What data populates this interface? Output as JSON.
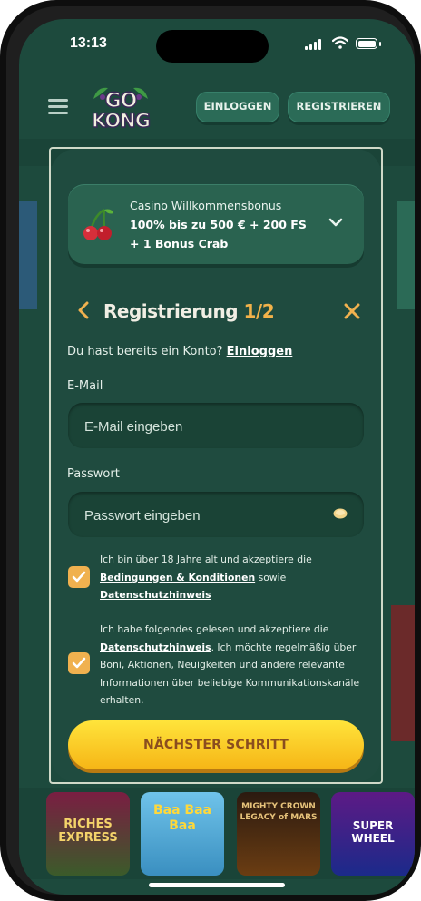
{
  "status_bar": {
    "time": "13:13"
  },
  "header": {
    "logo_top": "GO",
    "logo_bottom": "KONG",
    "login_label": "EINLOGGEN",
    "register_label": "REGISTRIEREN"
  },
  "bonus": {
    "title": "Casino Willkommensbonus",
    "line1": "100% bis zu 500 € + 200 FS",
    "line2": "+ 1 Bonus Crab"
  },
  "registration": {
    "title": "Registrierung",
    "step": "1/2",
    "have_account_text": "Du hast bereits ein Konto?",
    "login_link": "Einloggen",
    "email_label": "E-Mail",
    "email_placeholder": "E-Mail eingeben",
    "password_label": "Passwort",
    "password_placeholder": "Passwort eingeben",
    "consent1": {
      "text_a": "Ich bin über 18 Jahre alt und akzeptiere die",
      "link_a": "Bedingungen & Konditionen",
      "text_b": "sowie",
      "link_b": "Datenschutzhinweis"
    },
    "consent2": {
      "text_a": "Ich habe folgendes gelesen und akzeptiere die",
      "link_a": "Datenschutzhinweis",
      "text_b": ". Ich möchte regelmäßig über Boni, Aktionen, Neuigkeiten und andere relevante Informationen über beliebige Kommunikationskanäle erhalten."
    },
    "next_button": "NÄCHSTER SCHRITT"
  },
  "games": [
    {
      "label": "RICHES EXPRESS"
    },
    {
      "label": "Baa Baa Baa"
    },
    {
      "label": "MIGHTY CROWN LEGACY of MARS"
    },
    {
      "label": "SUPER WHEEL"
    }
  ],
  "colors": {
    "background": "#1d4a3d",
    "accent_orange": "#f0b14f",
    "cta_yellow": "#ffd02a"
  }
}
